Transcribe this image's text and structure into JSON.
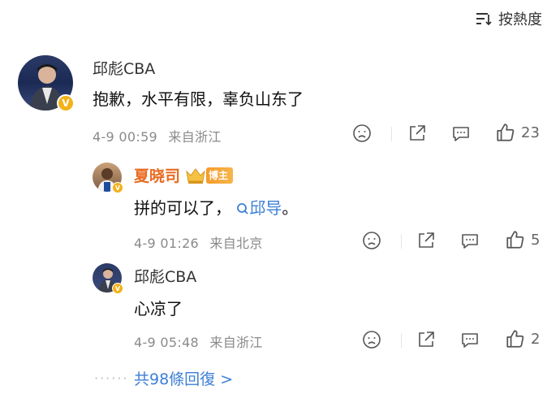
{
  "sort": {
    "label": "按熱度"
  },
  "comment": {
    "user": "邱彪CBA",
    "text": "抱歉，水平有限，辜负山东了",
    "time": "4-9 00:59",
    "location": "来自浙江",
    "likes": "23"
  },
  "replies": [
    {
      "user": "夏晓司",
      "tag": "博主",
      "text_prefix": "拼的可以了，",
      "mention": "邱导",
      "text_suffix": "。",
      "time": "4-9 01:26",
      "location": "来自北京",
      "likes": "5"
    },
    {
      "user": "邱彪CBA",
      "text": "心凉了",
      "time": "4-9 05:48",
      "location": "来自浙江",
      "likes": "2"
    }
  ],
  "more": {
    "label": "共98條回復 >"
  },
  "colors": {
    "accent_blue": "#3d7fd6",
    "name_orange": "#e96a1f",
    "vip_gold": "#f3b21a"
  },
  "icons": [
    "sort-icon",
    "dislike-icon",
    "share-icon",
    "comment-icon",
    "like-icon",
    "verified-v-icon",
    "crown-icon"
  ]
}
